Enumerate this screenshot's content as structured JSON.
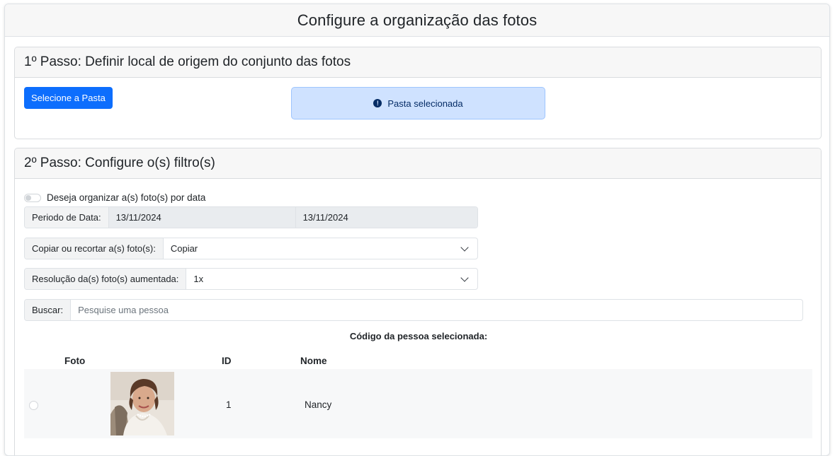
{
  "page": {
    "title": "Configure a organização das fotos"
  },
  "step1": {
    "title": "1º Passo: Definir local de origem do conjunto das fotos",
    "select_folder_button": "Selecione a Pasta",
    "alert_text": "Pasta selecionada",
    "alert_icon": "info-circle-icon"
  },
  "step2": {
    "title": "2º Passo: Configure o(s) filtro(s)",
    "organize_by_date_label": "Deseja organizar a(s) foto(s) por data",
    "organize_by_date_enabled": false,
    "date_period": {
      "label": "Periodo de Data:",
      "start": "13/11/2024",
      "end": "13/11/2024"
    },
    "copy_or_cut": {
      "label": "Copiar ou recortar a(s) foto(s):",
      "selected": "Copiar"
    },
    "resolution": {
      "label": "Resolução da(s) foto(s) aumentada:",
      "selected": "1x"
    },
    "search": {
      "label": "Buscar:",
      "placeholder": "Pesquise uma pessoa"
    },
    "selected_person_code_label": "Código da pessoa selecionada:",
    "table": {
      "columns": [
        "Foto",
        "ID",
        "Nome"
      ],
      "rows": [
        {
          "id": "1",
          "name": "Nancy",
          "selected": false
        }
      ]
    }
  },
  "colors": {
    "primary": "#0d6efd",
    "alert_bg": "#cfe2ff",
    "alert_text": "#052c65"
  }
}
